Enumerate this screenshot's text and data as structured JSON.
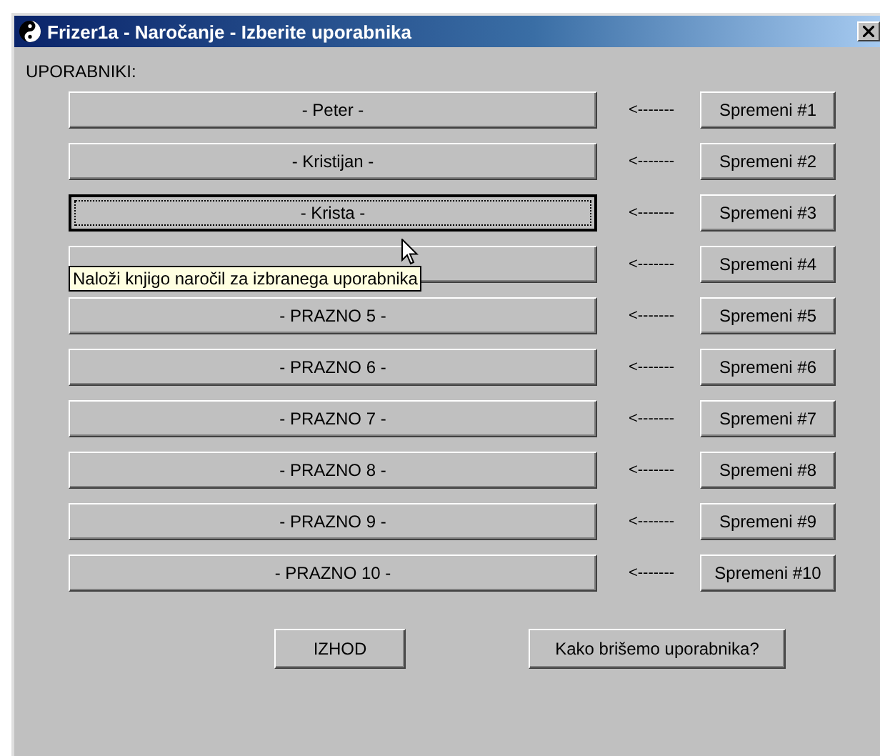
{
  "window": {
    "title": "Frizer1a - Naročanje - Izberite uporabnika"
  },
  "section_label": "UPORABNIKI:",
  "users": [
    {
      "label": "- Peter -",
      "selected": false,
      "arrow": "<-------",
      "edit_button": "Spremeni #1"
    },
    {
      "label": "- Kristijan -",
      "selected": false,
      "arrow": "<-------",
      "edit_button": "Spremeni #2"
    },
    {
      "label": "- Krista -",
      "selected": true,
      "arrow": "<-------",
      "edit_button": "Spremeni #3"
    },
    {
      "selected": false,
      "arrow": "<-------",
      "edit_button": "Spremeni #4"
    },
    {
      "label": "- PRAZNO 5 -",
      "selected": false,
      "arrow": "<-------",
      "edit_button": "Spremeni #5"
    },
    {
      "label": "- PRAZNO 6 -",
      "selected": false,
      "arrow": "<-------",
      "edit_button": "Spremeni #6"
    },
    {
      "label": "- PRAZNO 7 -",
      "selected": false,
      "arrow": "<-------",
      "edit_button": "Spremeni #7"
    },
    {
      "label": "- PRAZNO 8 -",
      "selected": false,
      "arrow": "<-------",
      "edit_button": "Spremeni #8"
    },
    {
      "label": "- PRAZNO 9 -",
      "selected": false,
      "arrow": "<-------",
      "edit_button": "Spremeni #9"
    },
    {
      "label": "- PRAZNO 10 -",
      "selected": false,
      "arrow": "<-------",
      "edit_button": "Spremeni #10"
    }
  ],
  "tooltip": "Naloži knjigo naročil za izbranega uporabnika",
  "buttons": [
    "IZHOD",
    "Kako brišemo uporabnika?"
  ]
}
